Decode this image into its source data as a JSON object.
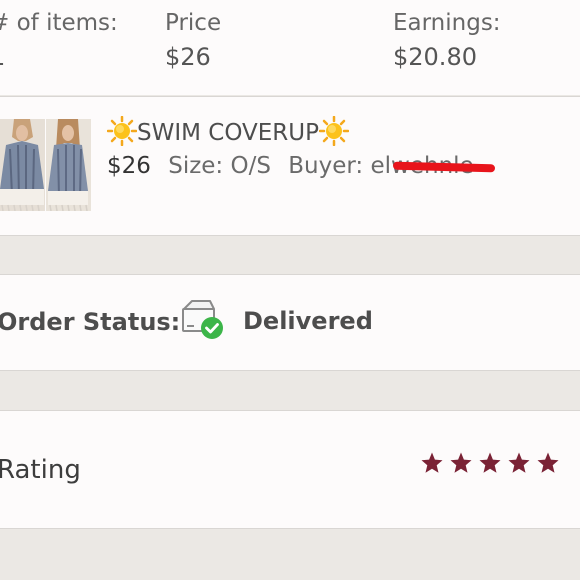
{
  "summary": {
    "items_label": "# of items:",
    "items_value": "1",
    "price_label": "Price",
    "price_value": "$26",
    "earnings_label": "Earnings:",
    "earnings_value": "$20.80"
  },
  "listing": {
    "title": "SWIM COVERUP",
    "title_icon": "sun-emoji",
    "price": "$26",
    "size": "Size: O/S",
    "buyer": "Buyer: elwehnle",
    "buyer_redacted": true,
    "redaction_color": "#e8141b"
  },
  "status": {
    "label": "Order Status:",
    "value": "Delivered",
    "icon": "package-delivered-icon",
    "check_color": "#3cb549"
  },
  "rating": {
    "label": "Rating",
    "stars_filled": 5,
    "stars_total": 5,
    "star_color": "#7a2235"
  },
  "colors": {
    "background": "#ebe8e4",
    "card": "#fdfbfb",
    "text": "#555555"
  }
}
